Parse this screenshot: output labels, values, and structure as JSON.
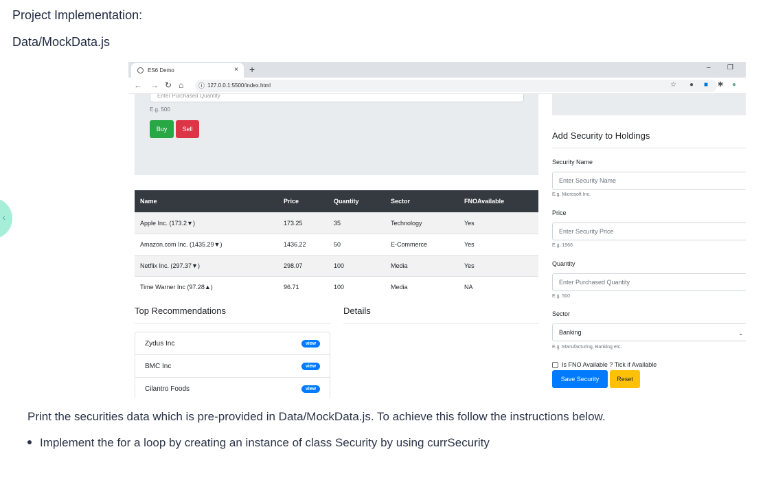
{
  "doc": {
    "heading": "Project Implementation:",
    "file": "Data/MockData.js",
    "paragraph": "Print the securities data which is pre-provided in Data/MockData.js. To achieve this follow the instructions below.",
    "bullet": "Implement the for a loop by creating an instance of class Security by using currSecurity"
  },
  "browser": {
    "tab_title": "ES6 Demo",
    "close_glyph": "×",
    "newtab_glyph": "+",
    "url": "127.0.0.1:5500/index.html",
    "minimize_glyph": "–",
    "restore_glyph": "❐"
  },
  "trade": {
    "qty_placeholder": "Enter Purchased Quantity",
    "qty_hint": "E.g. 500",
    "buy_label": "Buy",
    "sell_label": "Sell"
  },
  "table": {
    "headers": [
      "Name",
      "Price",
      "Quantity",
      "Sector",
      "FNOAvailable"
    ],
    "rows": [
      [
        "Apple Inc. (173.2▼)",
        "173.25",
        "35",
        "Technology",
        "Yes"
      ],
      [
        "Amazon.com Inc. (1435.29▼)",
        "1436.22",
        "50",
        "E-Commerce",
        "Yes"
      ],
      [
        "Netflix Inc. (297.37▼)",
        "298.07",
        "100",
        "Media",
        "Yes"
      ],
      [
        "Time Warner Inc (97.28▲)",
        "96.71",
        "100",
        "Media",
        "NA"
      ]
    ]
  },
  "recommendations": {
    "title": "Top Recommendations",
    "items": [
      "Zydus Inc",
      "BMC Inc",
      "Cilantro Foods"
    ],
    "view_label": "view"
  },
  "details": {
    "title": "Details"
  },
  "form": {
    "title": "Add Security to Holdings",
    "name_label": "Security Name",
    "name_placeholder": "Enter Security Name",
    "name_hint": "E.g. Microsoft Inc.",
    "price_label": "Price",
    "price_placeholder": "Enter Security Price",
    "price_hint": "E.g. 1966",
    "qty_label": "Quantity",
    "qty_placeholder": "Enter Purchased Quantity",
    "qty_hint": "E.g. 500",
    "sector_label": "Sector",
    "sector_value": "Banking",
    "sector_hint": "E.g. Manufacturing, Banking etc.",
    "fno_label": "Is FNO Available ? Tick if Available",
    "save_label": "Save Security",
    "reset_label": "Reset"
  },
  "colors": {
    "buy": "#28a745",
    "sell": "#dc3545",
    "primary": "#007bff",
    "reset": "#ffc107",
    "table_header": "#343a40"
  }
}
